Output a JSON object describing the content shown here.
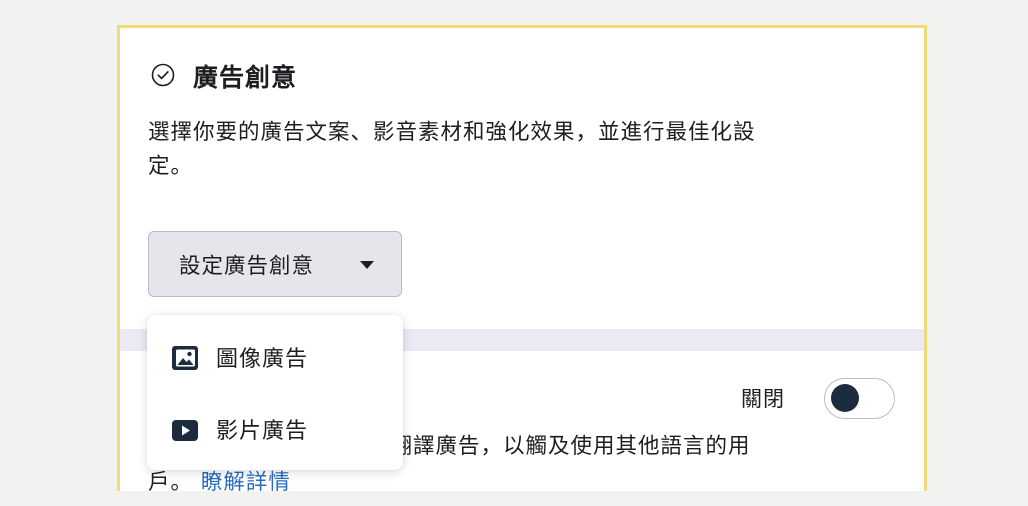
{
  "ad_creative": {
    "title": "廣告創意",
    "description_line1": "選擇你要的廣告文案、影音素材和強化效果，並進行最佳化設",
    "description_line2": "定。",
    "setup_button_label": "設定廣告創意"
  },
  "dropdown": {
    "items": [
      {
        "label": "圖像廣告",
        "icon": "image-icon"
      },
      {
        "label": "影片廣告",
        "icon": "video-play-icon"
      }
    ]
  },
  "auto_translate": {
    "toggle_label": "關閉",
    "toggle_state": "off",
    "description_visible": "動翻譯廣告，以觸及使用其他語言的用",
    "description_line2_start": "戶。",
    "learn_more": "瞭解詳情"
  },
  "colors": {
    "panel_border": "#f0da7a",
    "button_bg": "#e4e6eb",
    "band": "#ebe9f3",
    "link": "#2b6cbf",
    "toggle_knob": "#1c2b3d"
  }
}
